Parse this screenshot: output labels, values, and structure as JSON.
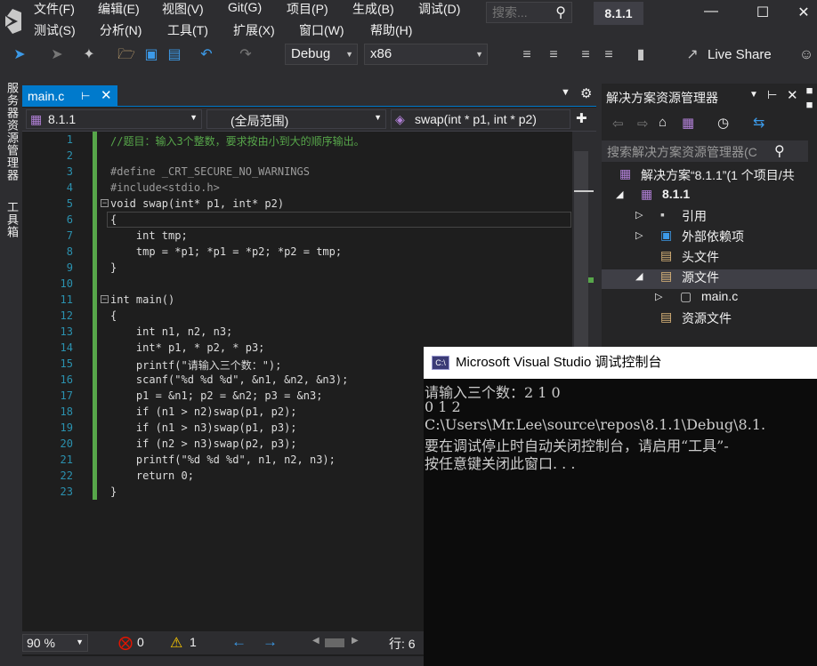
{
  "menu": {
    "row1": [
      "文件(F)",
      "编辑(E)",
      "视图(V)",
      "Git(G)",
      "项目(P)",
      "生成(B)",
      "调试(D)"
    ],
    "row2": [
      "测试(S)",
      "分析(N)",
      "工具(T)",
      "扩展(X)",
      "窗口(W)",
      "帮助(H)"
    ],
    "search_placeholder": "搜索...",
    "solution_name": "8.1.1"
  },
  "toolbar": {
    "config": "Debug",
    "platform": "x86",
    "live_share": "Live Share"
  },
  "left_strip": [
    "服务器资源管理器",
    "工具箱"
  ],
  "editor": {
    "tab": "main.c",
    "nav_project": "8.1.1",
    "nav_scope": "(全局范围)",
    "nav_func": "swap(int * p1, int * p2)",
    "lines": [
      {
        "n": "1",
        "t": "//题目：输入3个整数，要求按由小到大的顺序输出。"
      },
      {
        "n": "2",
        "t": ""
      },
      {
        "n": "3",
        "t": "#define _CRT_SECURE_NO_WARNINGS"
      },
      {
        "n": "4",
        "t": "#include<stdio.h>"
      },
      {
        "n": "5",
        "t": "void swap(int* p1, int* p2)"
      },
      {
        "n": "6",
        "t": "{"
      },
      {
        "n": "7",
        "t": "    int tmp;"
      },
      {
        "n": "8",
        "t": "    tmp = *p1; *p1 = *p2; *p2 = tmp;"
      },
      {
        "n": "9",
        "t": "}"
      },
      {
        "n": "10",
        "t": ""
      },
      {
        "n": "11",
        "t": "int main()"
      },
      {
        "n": "12",
        "t": "{"
      },
      {
        "n": "13",
        "t": "    int n1, n2, n3;"
      },
      {
        "n": "14",
        "t": "    int* p1, * p2, * p3;"
      },
      {
        "n": "15",
        "t": "    printf(\"请输入三个数：\");"
      },
      {
        "n": "16",
        "t": "    scanf(\"%d %d %d\", &n1, &n2, &n3);"
      },
      {
        "n": "17",
        "t": "    p1 = &n1; p2 = &n2; p3 = &n3;"
      },
      {
        "n": "18",
        "t": "    if (n1 > n2)swap(p1, p2);"
      },
      {
        "n": "19",
        "t": "    if (n1 > n3)swap(p1, p3);"
      },
      {
        "n": "20",
        "t": "    if (n2 > n3)swap(p2, p3);"
      },
      {
        "n": "21",
        "t": "    printf(\"%d %d %d\", n1, n2, n3);"
      },
      {
        "n": "22",
        "t": "    return 0;"
      },
      {
        "n": "23",
        "t": "}"
      }
    ]
  },
  "status": {
    "zoom": "90 %",
    "errors": "0",
    "warnings": "1",
    "line": "行: 6"
  },
  "solution_explorer": {
    "title": "解决方案资源管理器",
    "search_placeholder": "搜索解决方案资源管理器(C",
    "items": [
      {
        "label": "解决方案“8.1.1”(1 个项目/共"
      },
      {
        "label": "8.1.1"
      },
      {
        "label": "引用"
      },
      {
        "label": "外部依赖项"
      },
      {
        "label": "头文件"
      },
      {
        "label": "源文件"
      },
      {
        "label": "main.c"
      },
      {
        "label": "资源文件"
      }
    ]
  },
  "console": {
    "title": "Microsoft Visual Studio 调试控制台",
    "lines": [
      "请输入三个数：2 1 0",
      "0 1 2",
      "C:\\Users\\Mr.Lee\\source\\repos\\8.1.1\\Debug\\8.1.",
      "要在调试停止时自动关闭控制台，请启用“工具”-",
      "按任意键关闭此窗口. . ."
    ]
  },
  "colors": {
    "accent": "#007acc",
    "background": "#2d2d30",
    "editor": "#1e1e1e"
  }
}
